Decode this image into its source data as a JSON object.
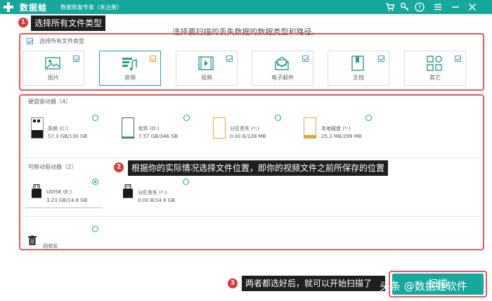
{
  "titlebar": {
    "app_name": "数据蛙",
    "app_subtitle": "数据恢复专家（未注册）",
    "icons": [
      "cart-icon",
      "key-icon",
      "help-icon",
      "menu-icon",
      "minimize-icon",
      "close-icon"
    ]
  },
  "callouts": [
    {
      "num": "1",
      "text": "选择所有文件类型"
    },
    {
      "num": "2",
      "text": "根据你的实际情况选择文件位置，即你的视频文件之前所保存的位置"
    },
    {
      "num": "3",
      "text": "两者都选好后，就可以开始扫描了"
    }
  ],
  "headline": "选择要扫描的丢失数据的数据类型和路径。",
  "file_types": {
    "select_all_label": "选择所有文件类型",
    "items": [
      {
        "label": "图片",
        "icon": "image-icon"
      },
      {
        "label": "音频",
        "icon": "audio-icon"
      },
      {
        "label": "视频",
        "icon": "video-icon"
      },
      {
        "label": "电子邮件",
        "icon": "email-icon"
      },
      {
        "label": "文档",
        "icon": "document-icon"
      },
      {
        "label": "其它",
        "icon": "other-icon"
      }
    ]
  },
  "hard_drives": {
    "title": "硬盘驱动器（4）",
    "items": [
      {
        "name": "系统 (C:)",
        "size": "57.3 GB/130 GB"
      },
      {
        "name": "软件 (D:)",
        "size": "7.57 GB/346 GB"
      },
      {
        "name": "分区丢失 (*:)",
        "size": "0.00  B/128 MB"
      },
      {
        "name": "本地磁盘 (*:)",
        "size": "25.3 MB/299 MB"
      }
    ]
  },
  "removable_drives": {
    "title": "可移动驱动器（2）",
    "items": [
      {
        "name": "UDISK (E:)",
        "size": "3.23 GB/14.6 GB"
      },
      {
        "name": "分区丢失 (*:)",
        "size": "0.00  B/14.6 GB"
      }
    ]
  },
  "recycle_bin": {
    "label": "回收站"
  },
  "scan_button": {
    "label": "扫描"
  },
  "watermark": "头条 @数据蛙软件",
  "colors": {
    "accent": "#17a79c",
    "highlight": "#e05a5e",
    "badge": "#e0353b"
  }
}
